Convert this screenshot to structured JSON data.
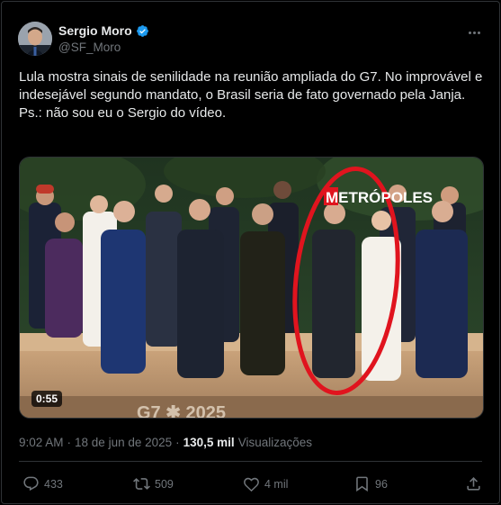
{
  "author": {
    "name": "Sergio Moro",
    "handle": "@SF_Moro"
  },
  "tweet": {
    "paragraph1": "Lula mostra sinais de senilidade na reunião ampliada do G7. No improvável e indesejável segundo mandato, o Brasil seria de fato governado pela Janja.",
    "paragraph2": "Ps.: não sou eu o Sergio do vídeo."
  },
  "media": {
    "duration": "0:55",
    "watermark": "METRÓPOLES",
    "banner": "G7 ✱ 2025"
  },
  "meta": {
    "time": "9:02 AM",
    "separator": "·",
    "date": "18 de jun de 2025",
    "views_count": "130,5 mil",
    "views_label": "Visualizações"
  },
  "actions": {
    "replies": "433",
    "reposts": "509",
    "likes": "4 mil",
    "bookmarks": "96"
  },
  "colors": {
    "background": "#000000",
    "text": "#e7e9ea",
    "muted": "#71767b",
    "verified": "#1d9bf0",
    "highlight_circle": "#e0141e"
  }
}
